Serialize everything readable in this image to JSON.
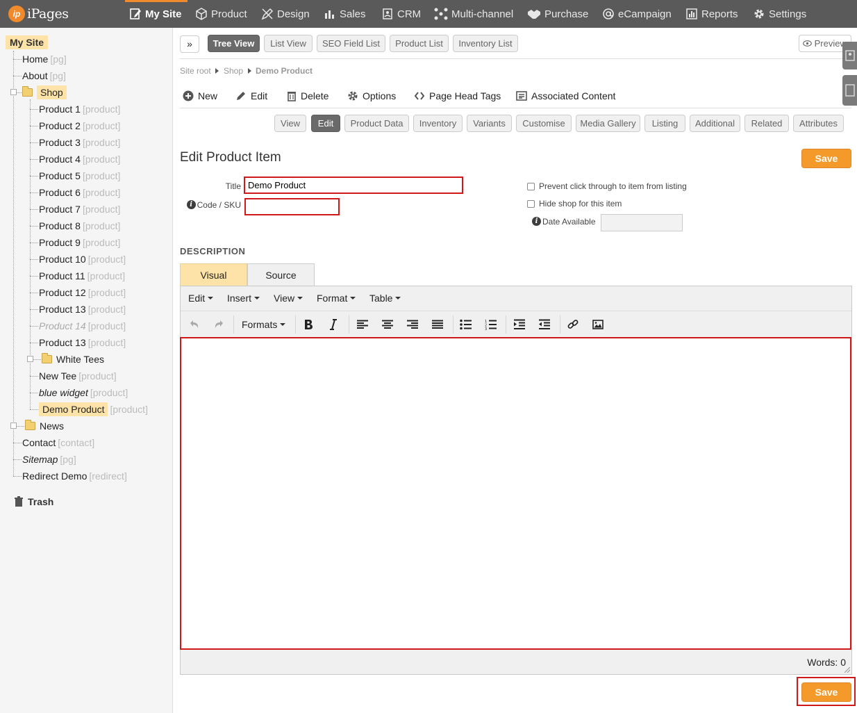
{
  "app": {
    "logo_mark": "ip",
    "logo_text": "iPages"
  },
  "nav": [
    {
      "label": "My Site",
      "icon": "edit-page-icon",
      "active": true
    },
    {
      "label": "Product",
      "icon": "cubes-icon"
    },
    {
      "label": "Design",
      "icon": "pencil-ruler-icon"
    },
    {
      "label": "Sales",
      "icon": "bar-cart-icon"
    },
    {
      "label": "CRM",
      "icon": "contact-card-icon"
    },
    {
      "label": "Multi-channel",
      "icon": "network-icon"
    },
    {
      "label": "Purchase",
      "icon": "handshake-icon"
    },
    {
      "label": "eCampaign",
      "icon": "at-sign-icon"
    },
    {
      "label": "Reports",
      "icon": "chart-icon"
    },
    {
      "label": "Settings",
      "icon": "gear-icon"
    }
  ],
  "tree": {
    "root": "My Site",
    "nodes": [
      {
        "label": "Home",
        "type": "[pg]"
      },
      {
        "label": "About",
        "type": "[pg]"
      },
      {
        "label": "Shop",
        "type": ""
      },
      {
        "label": "Product 1",
        "type": "[product]"
      },
      {
        "label": "Product 2",
        "type": "[product]"
      },
      {
        "label": "Product 3",
        "type": "[product]"
      },
      {
        "label": "Product 4",
        "type": "[product]"
      },
      {
        "label": "Product 5",
        "type": "[product]"
      },
      {
        "label": "Product 6",
        "type": "[product]"
      },
      {
        "label": "Product 7",
        "type": "[product]"
      },
      {
        "label": "Product 8",
        "type": "[product]"
      },
      {
        "label": "Product 9",
        "type": "[product]"
      },
      {
        "label": "Product 10",
        "type": "[product]"
      },
      {
        "label": "Product 11",
        "type": "[product]"
      },
      {
        "label": "Product 12",
        "type": "[product]"
      },
      {
        "label": "Product 13",
        "type": "[product]"
      },
      {
        "label": "Product 14",
        "type": "[product]"
      },
      {
        "label": "Product 13",
        "type": "[product]"
      },
      {
        "label": "White Tees",
        "type": ""
      },
      {
        "label": "New Tee",
        "type": "[product]"
      },
      {
        "label": "blue widget",
        "type": "[product]"
      },
      {
        "label": "Demo Product",
        "type": "[product]"
      },
      {
        "label": "News",
        "type": ""
      },
      {
        "label": "Contact",
        "type": "[contact]"
      },
      {
        "label": "Sitemap",
        "type": "[pg]"
      },
      {
        "label": "Redirect Demo",
        "type": "[redirect]"
      }
    ],
    "trash": "Trash"
  },
  "views": {
    "expand": "»",
    "tree_view": "Tree View",
    "list_view": "List View",
    "seo_field_list": "SEO Field List",
    "product_list": "Product List",
    "inventory_list": "Inventory List",
    "preview": "Preview"
  },
  "breadcrumb": [
    "Site root",
    "Shop",
    "Demo Product"
  ],
  "actions": {
    "new": "New",
    "edit": "Edit",
    "delete": "Delete",
    "options": "Options",
    "page_head_tags": "Page Head Tags",
    "associated_content": "Associated Content"
  },
  "subtabs": [
    "View",
    "Edit",
    "Product Data",
    "Inventory",
    "Variants",
    "Customise",
    "Media Gallery",
    "Listing",
    "Additional",
    "Related",
    "Attributes"
  ],
  "form": {
    "heading": "Edit Product Item",
    "save": "Save",
    "title_label": "Title",
    "title_value": "Demo Product",
    "sku_label": "Code / SKU",
    "sku_value": "",
    "info": "i",
    "prevent_click": "Prevent click through to item from listing",
    "hide_shop": "Hide shop for this item",
    "date_available": "Date Available",
    "date_value": ""
  },
  "description": {
    "heading": "DESCRIPTION",
    "tab_visual": "Visual",
    "tab_source": "Source",
    "menus": [
      "Edit",
      "Insert",
      "View",
      "Format",
      "Table"
    ],
    "formats": "Formats",
    "words": "Words: 0"
  }
}
